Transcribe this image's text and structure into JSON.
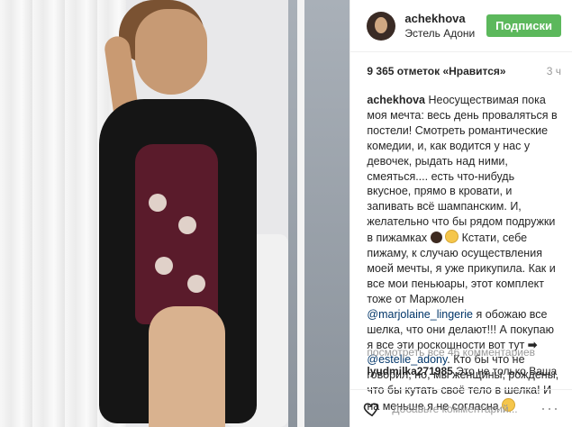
{
  "post": {
    "username": "achekhova",
    "location": "Эстель Адони",
    "follow_label": "Подписки",
    "likes": "9 365 отметок «Нравится»",
    "time": "3 ч",
    "caption_user": "achekhova",
    "caption_1": "Неосуществимая пока моя мечта: весь день проваляться в постели! Смотреть романтические комедии, и, как водится у нас у девочек, рыдать над ними, смеяться.... есть что-нибудь вкусное, прямо в кровати, и запивать всё шампанским. И, желательно что бы рядом подружки в пижамках",
    "caption_2": "Кстати, себе пижаму, к случаю осуществления моей мечты, я уже прикупила. Как и все мои пеньюары, этот комплект тоже от Маржолен",
    "mention_1": "@marjolaine_lingerie",
    "caption_3": "я обожаю все шелка, что они делают!!! А покупаю я все эти роскошности вот тут",
    "arrow": "➡",
    "mention_2": "@estelle_adony",
    "caption_4": ". Кто бы что не говорил, но, мы женщины, рождены, что бы кутать своё тело в шелка! И на меньше я не согласна",
    "view_all": "посмотреть все 46 комментариев",
    "comment_user": "lyudmilka271985",
    "comment_text": "Это не только Ваша",
    "add_comment": "Добавьте комментарий...",
    "more": "···"
  },
  "icons": {
    "heart": "heart-icon",
    "more": "more-icon"
  },
  "colors": {
    "follow": "#5cb85c",
    "mention": "#003569",
    "muted": "#999999"
  }
}
